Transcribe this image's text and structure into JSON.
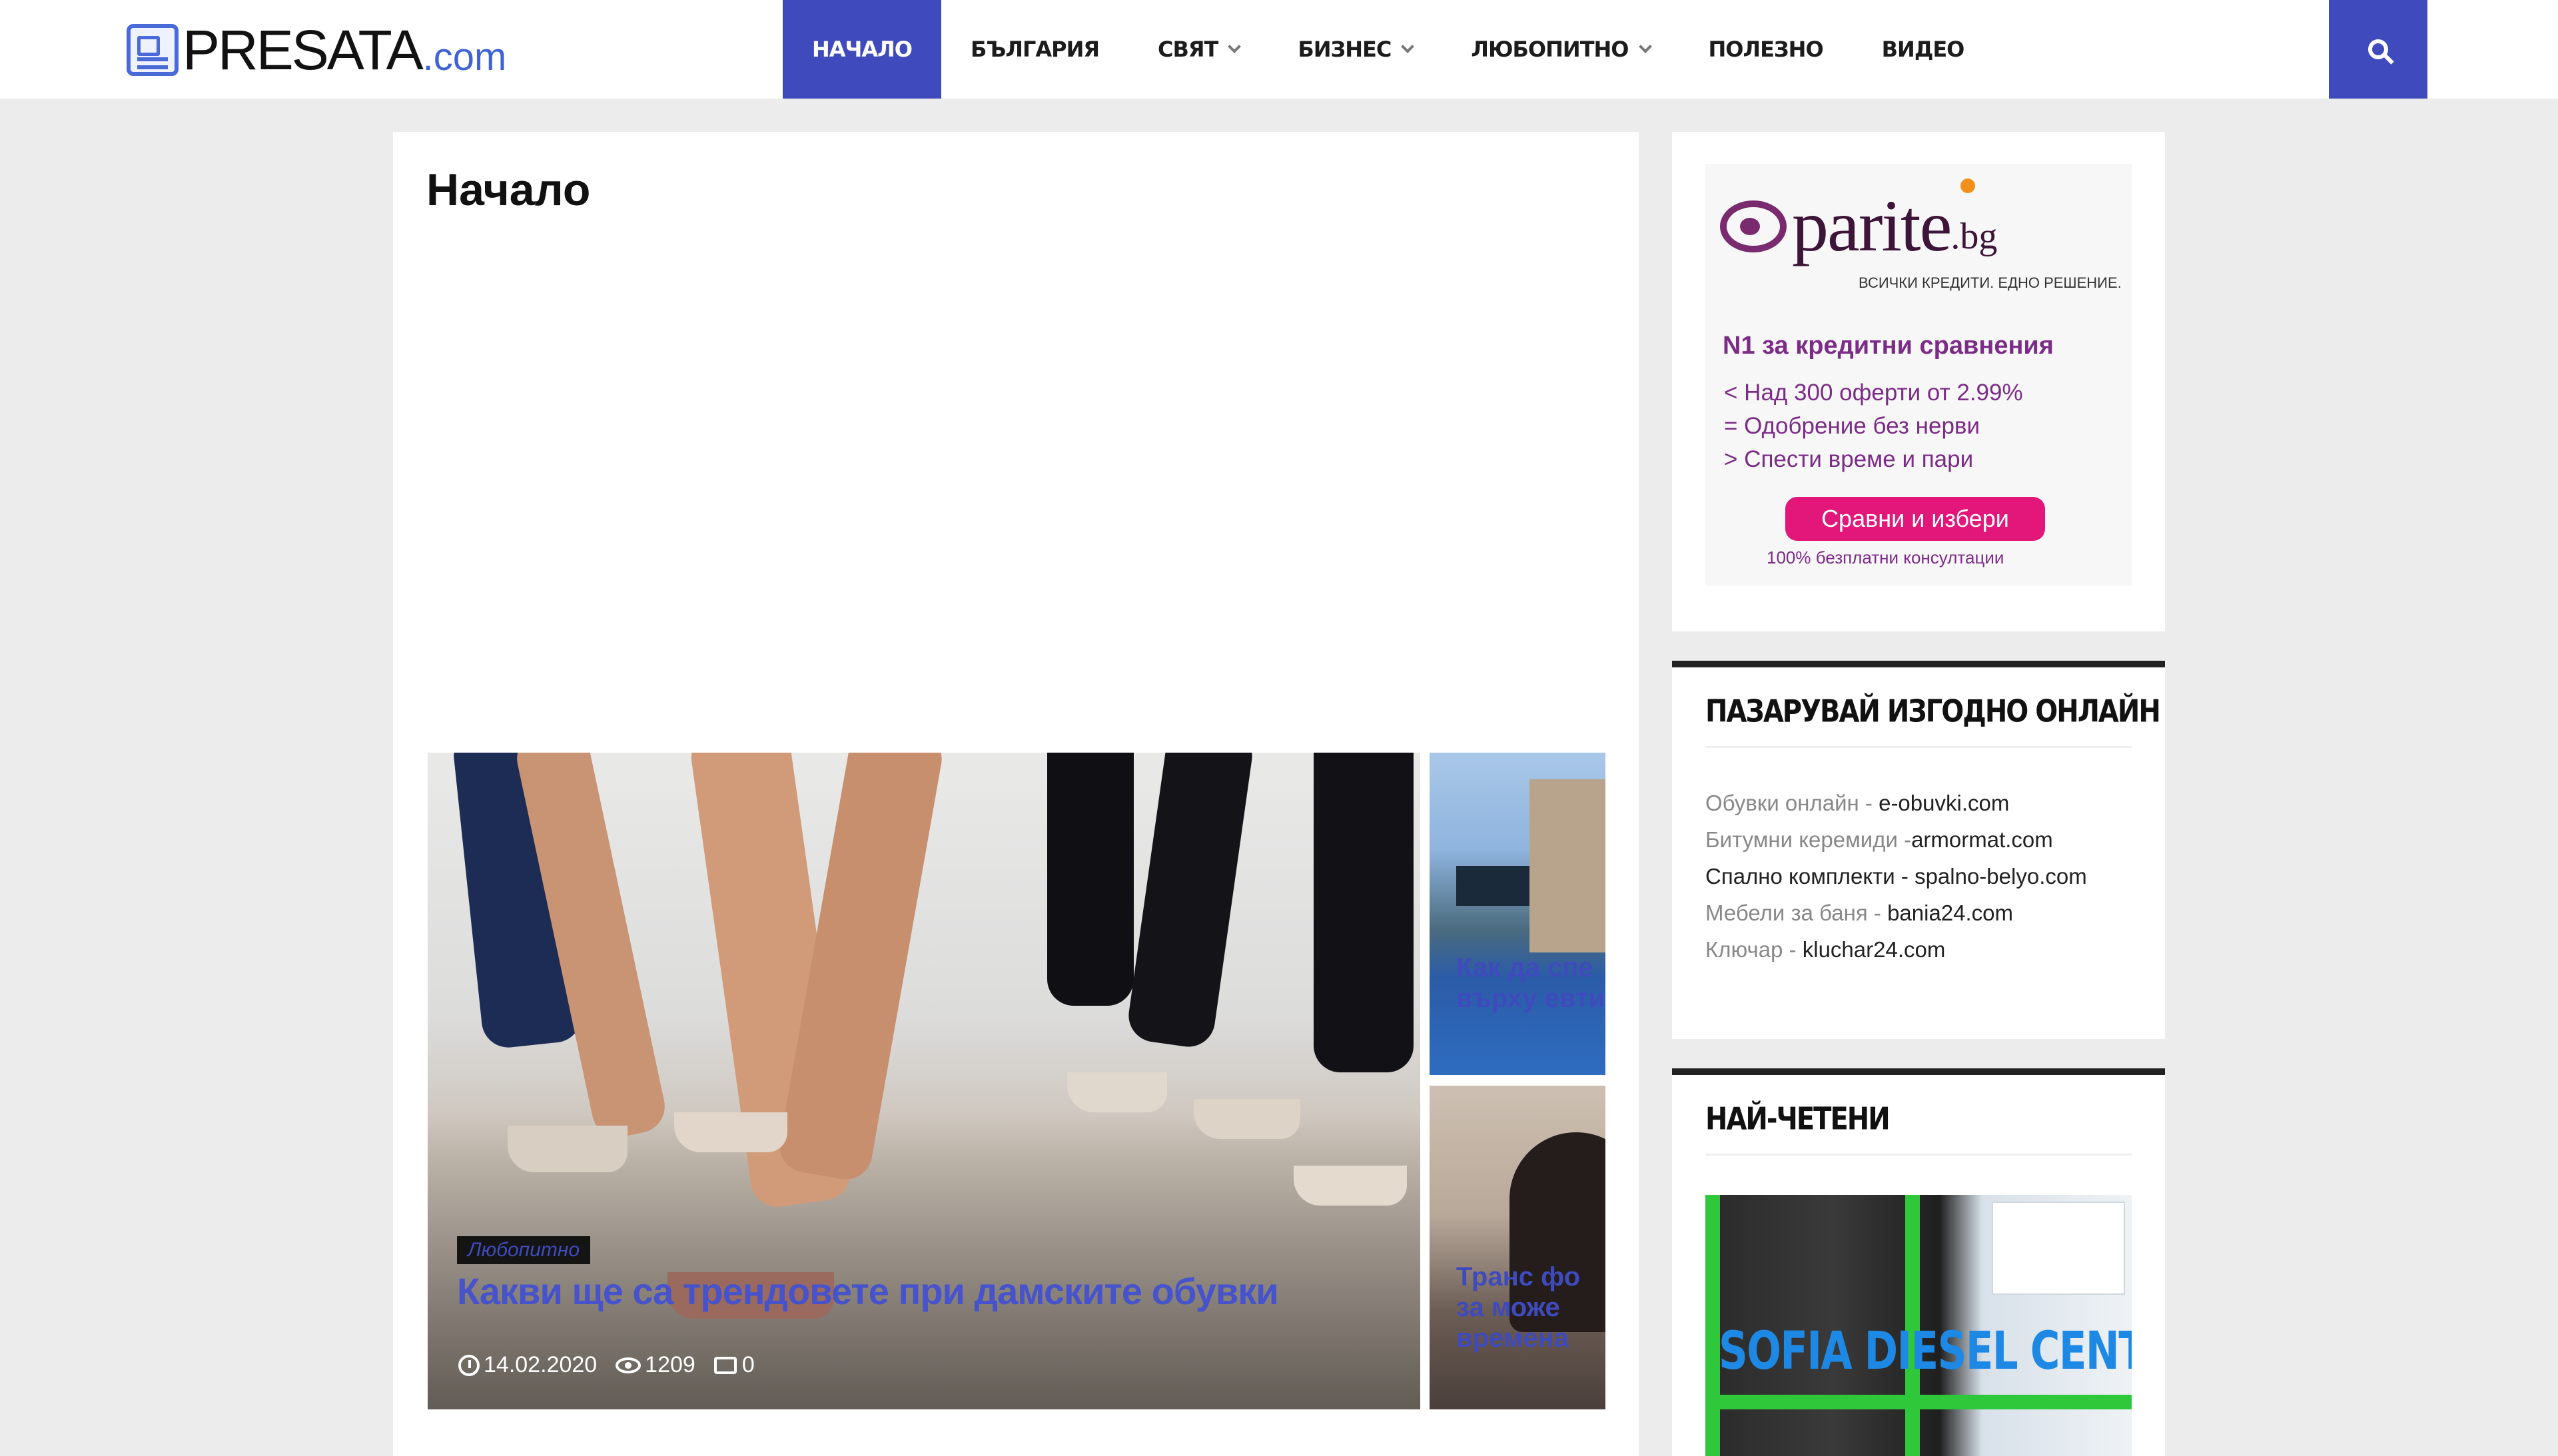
{
  "header": {
    "logo_text": "PRESATA",
    "logo_suffix": ".com",
    "nav": [
      {
        "label": "НАЧАЛО",
        "active": true
      },
      {
        "label": "БЪЛГАРИЯ"
      },
      {
        "label": "СВЯТ",
        "dropdown": true
      },
      {
        "label": "БИЗНЕС",
        "dropdown": true
      },
      {
        "label": "ЛЮБОПИТНО",
        "dropdown": true
      },
      {
        "label": "ПОЛЕЗНО"
      },
      {
        "label": "ВИДЕО"
      }
    ]
  },
  "main": {
    "page_title": "Начало",
    "featured": {
      "category": "Любопитно",
      "title": "Какви ще са трендовете при дамските обувки",
      "date": "14.02.2020",
      "views": "1209",
      "comments": "0"
    },
    "side_posts": [
      {
        "title_line1": "Как да спе",
        "title_line2": "върху евтин"
      },
      {
        "title_line1": "Транс фо",
        "title_line2": "за може",
        "title_line3": "времена"
      }
    ]
  },
  "sidebar": {
    "ad": {
      "brand": "parite",
      "brand_suffix": ".bg",
      "tagline": "ВСИЧКИ КРЕДИТИ. ЕДНО РЕШЕНИЕ.",
      "headline": "N1 за кредитни сравнения",
      "line1": "< Над 300 оферти от 2.99%",
      "line2": "= Одобрение без нерви",
      "line3": "> Спести време и пари",
      "cta": "Сравни и избери",
      "footer": "100% безплатни консултации"
    },
    "shop": {
      "title": "ПАЗАРУВАЙ ИЗГОДНО ОНЛАЙН",
      "items": [
        {
          "label": "Обувки онлайн - ",
          "site": "e-obuvki.com"
        },
        {
          "label": "Битумни керемиди -",
          "site": "armormat.com"
        },
        {
          "label": "",
          "site": "Спално комплекти - spalno-belyo.com"
        },
        {
          "label": "Мебели за баня - ",
          "site": "bania24.com"
        },
        {
          "label": "Ключар - ",
          "site": "kluchar24.com"
        }
      ]
    },
    "popular": {
      "title": "НАЙ-ЧЕТЕНИ",
      "image_overlay": "SOFIA DIESEL CENTE"
    }
  },
  "colors": {
    "accent": "#3f4bbd",
    "ad_purple": "#7b2c86",
    "ad_pink": "#e3167a"
  }
}
